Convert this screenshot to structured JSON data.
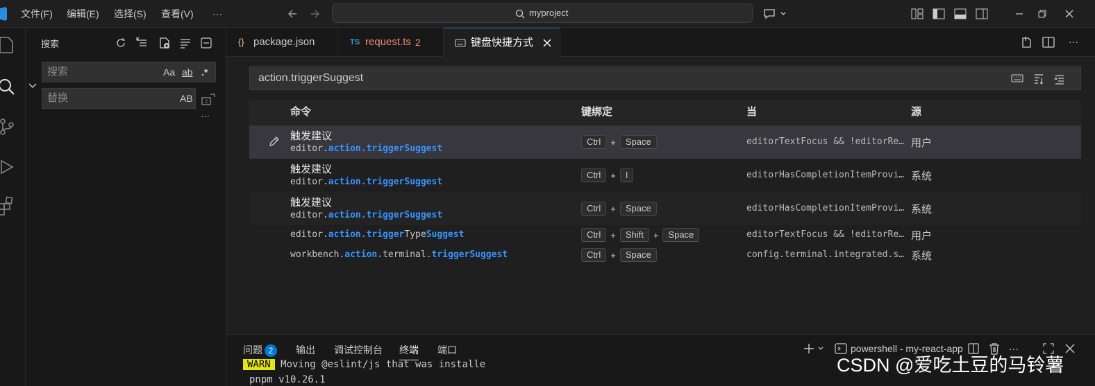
{
  "menubar": {
    "items": [
      "文件(F)",
      "编辑(E)",
      "选择(S)",
      "查看(V)",
      "···"
    ],
    "search_text": "myproject"
  },
  "sidebar": {
    "title": "搜索",
    "search_placeholder": "搜索",
    "replace_placeholder": "替换",
    "opt_case": "Aa",
    "opt_word": "ab",
    "opt_regex": ".*",
    "opt_preserve": "AB",
    "more": "···"
  },
  "tabs": [
    {
      "icon": "{}",
      "label": "package.json"
    },
    {
      "icon": "TS",
      "label": "request.ts",
      "count": "2"
    },
    {
      "label": "键盘快捷方式"
    }
  ],
  "keybindings": {
    "search_value": "action.triggerSuggest",
    "headers": {
      "command": "命令",
      "keybinding": "键绑定",
      "when": "当",
      "source": "源"
    },
    "rows": [
      {
        "title": "触发建议",
        "id_pre": "editor.",
        "id_hl": "action.triggerSuggest",
        "keys": [
          "Ctrl",
          "Space"
        ],
        "when": "editorTextFocus && !editorRe…",
        "source": "用户"
      },
      {
        "title": "触发建议",
        "id_pre": "editor.",
        "id_hl": "action.triggerSuggest",
        "keys": [
          "Ctrl",
          "I"
        ],
        "when": "editorHasCompletionItemProvi…",
        "source": "系统"
      },
      {
        "title": "触发建议",
        "id_pre": "editor.",
        "id_hl": "action.triggerSuggest",
        "keys": [
          "Ctrl",
          "Space"
        ],
        "when": "editorHasCompletionItemProvi…",
        "source": "系统"
      },
      {
        "id_pre": "editor.",
        "id_hl": "action.trigger",
        "id_mid": "Type",
        "id_hl2": "Suggest",
        "keys": [
          "Ctrl",
          "Shift",
          "Space"
        ],
        "when": "editorTextFocus && !editorRe…",
        "source": "用户"
      },
      {
        "id_pre": "workbench.",
        "id_hl": "action.",
        "id_mid": "terminal.",
        "id_hl2": "triggerSuggest",
        "keys": [
          "Ctrl",
          "Space"
        ],
        "when": "config.terminal.integrated.s…",
        "source": "系统"
      }
    ]
  },
  "panel": {
    "tabs": [
      "问题",
      "输出",
      "调试控制台",
      "终端",
      "端口"
    ],
    "problems_count": "2",
    "terminal_name": "powershell - my-react-app",
    "lines": {
      "warn_tag": "WARN",
      "warn_text": "Moving @eslint/js that was installe",
      "line2": "pnpm v10.26.1"
    }
  },
  "watermark": "CSDN @爱吃土豆的马铃薯",
  "colors": {
    "accent": "#0078d4",
    "highlight": "#3794ff",
    "error": "#f48771"
  }
}
